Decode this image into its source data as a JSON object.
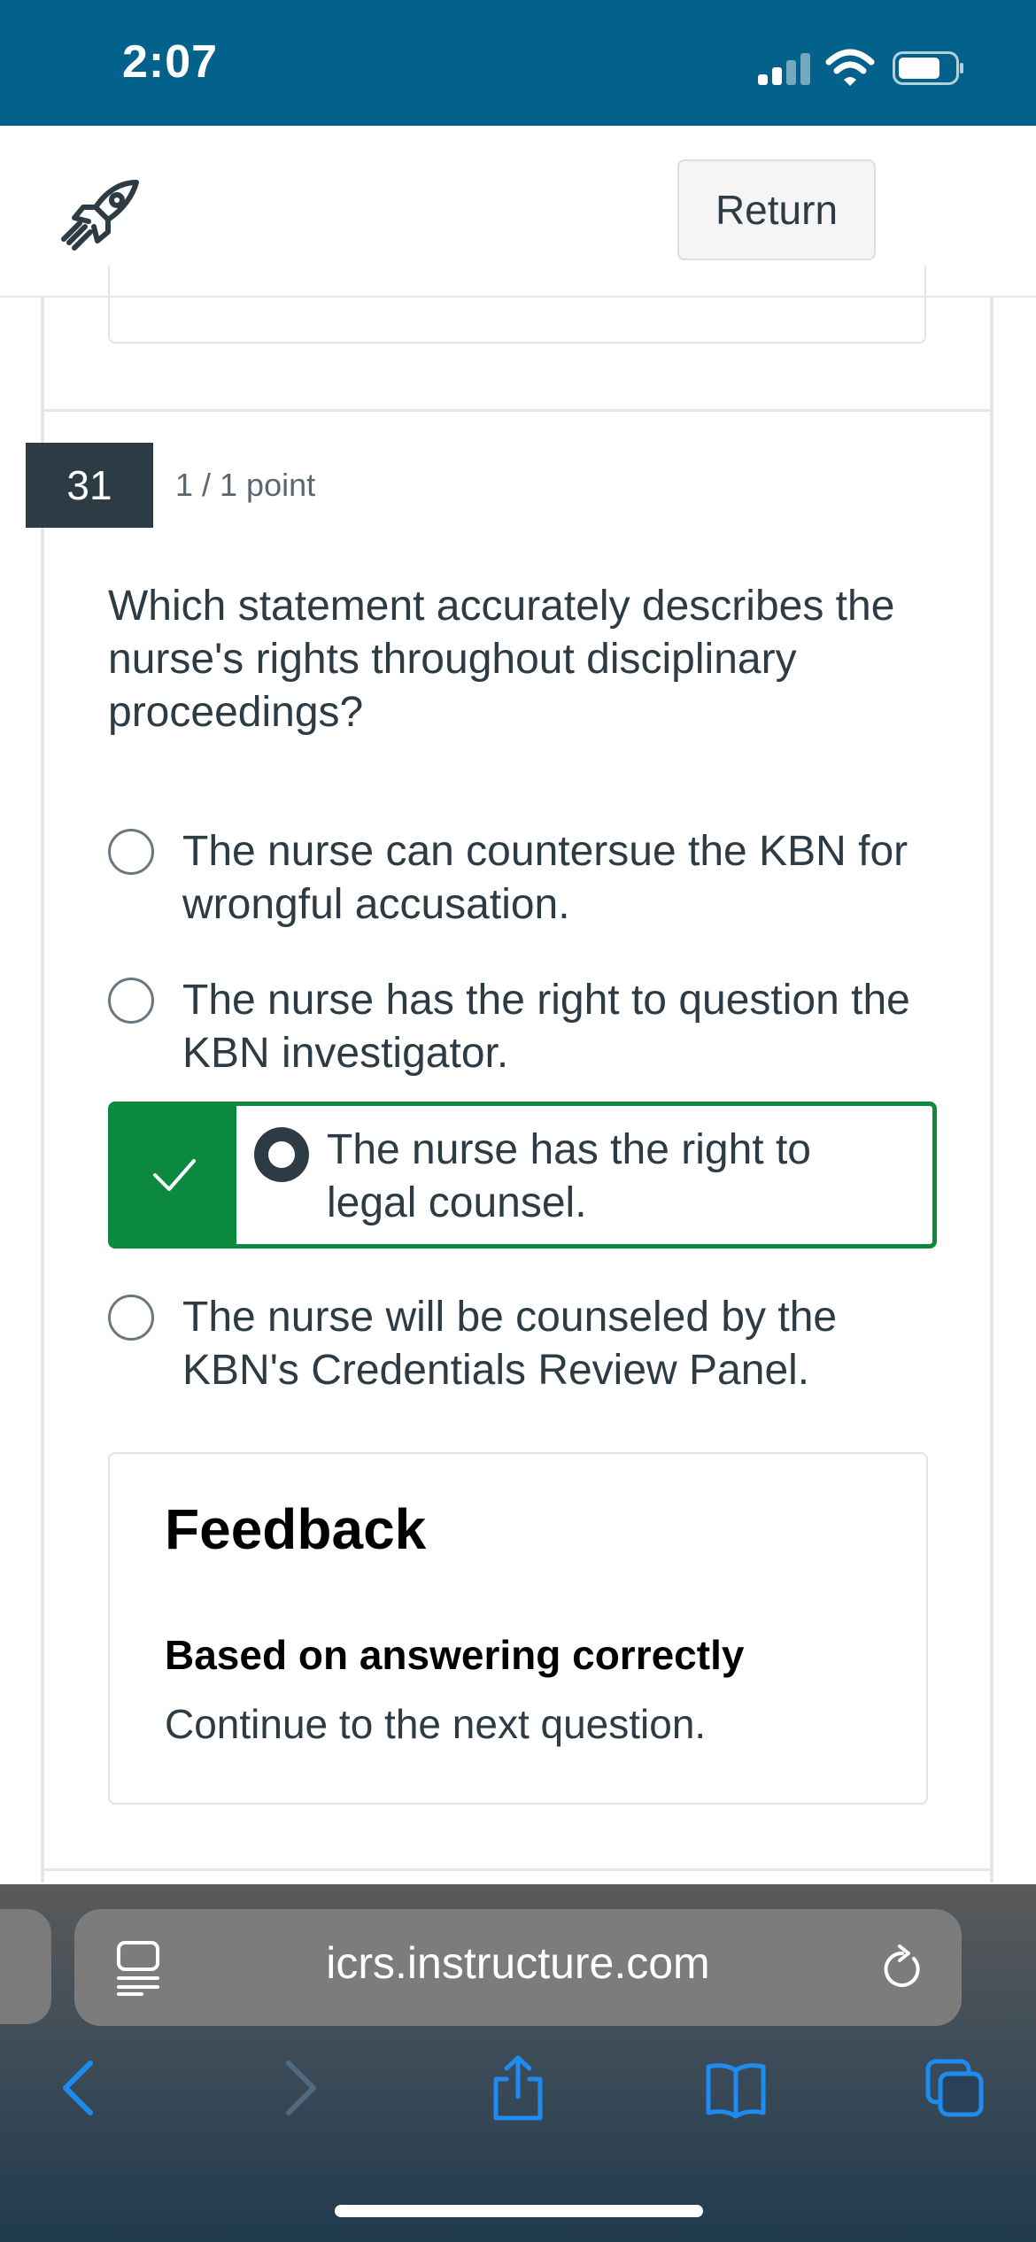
{
  "status_bar": {
    "time": "2:07"
  },
  "header": {
    "return_label": "Return"
  },
  "question": {
    "number": "31",
    "points": "1 / 1 point",
    "text": "Which statement accurately describes the nurse's rights throughout disciplinary proceedings?",
    "options": [
      {
        "text": "The nurse can countersue the KBN for wrongful accusation.",
        "selected": false
      },
      {
        "text": "The nurse has the right to question the KBN investigator.",
        "selected": false
      },
      {
        "text": "The nurse has the right to legal counsel.",
        "selected": true,
        "correct": true
      },
      {
        "text": "The nurse will be counseled by the KBN's Credentials Review Panel.",
        "selected": false
      }
    ]
  },
  "feedback": {
    "title": "Feedback",
    "subtitle": "Based on answering correctly",
    "text": "Continue to the next question."
  },
  "browser": {
    "address": "icrs.instructure.com"
  },
  "colors": {
    "status_bar": "#03628b",
    "correct": "#0b8a3f",
    "question_number_bg": "#2d3b45"
  }
}
